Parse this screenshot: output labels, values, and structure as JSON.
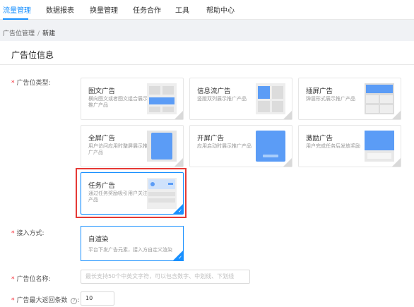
{
  "nav": {
    "items": [
      {
        "label": "流量管理",
        "active": true
      },
      {
        "label": "数据报表",
        "active": false
      },
      {
        "label": "换量管理",
        "active": false
      },
      {
        "label": "任务合作",
        "active": false
      },
      {
        "label": "工具",
        "active": false
      },
      {
        "label": "帮助中心",
        "active": false
      }
    ]
  },
  "breadcrumb": {
    "parent": "广告位管理",
    "separator": "/",
    "current": "新建"
  },
  "panel": {
    "title": "广告位信息"
  },
  "form": {
    "ad_type_label": "广告位类型:",
    "access_label": "接入方式:",
    "name_label": "广告位名称:",
    "max_count_label": "广告最大返回条数",
    "max_count_help_icon": "question-circle-icon",
    "max_count_suffix": ":"
  },
  "ad_types": [
    {
      "title": "图文广告",
      "desc": "横向图文或者图文组合展示推广产品",
      "thumb": "image-text"
    },
    {
      "title": "信息流广告",
      "desc": "竖版双列展示推广产品",
      "thumb": "feed"
    },
    {
      "title": "插屏广告",
      "desc": "弹层形式展示推广产品",
      "thumb": "interstitial"
    },
    {
      "title": "全屏广告",
      "desc": "用户访问应用时整屏展示推广产品",
      "thumb": "fullscreen"
    },
    {
      "title": "开屏广告",
      "desc": "应用启动时展示推广产品",
      "thumb": "splash"
    },
    {
      "title": "激励广告",
      "desc": "用户完成任务后发放奖励",
      "thumb": "reward"
    },
    {
      "title": "任务广告",
      "desc": "通过任务奖励吸引用户关注产品",
      "thumb": "task",
      "selected": true
    }
  ],
  "access": {
    "title": "自渲染",
    "desc": "平台下发广告元素，接入方自定义渲染",
    "selected": true
  },
  "name_input": {
    "value": "",
    "placeholder": "最长支持50个中英文字符，可以包含数字、中划线、下划线"
  },
  "max_count_input": {
    "value": "10"
  },
  "colors": {
    "accent": "#1890ff",
    "highlight": "#e53935",
    "required": "#f5222d"
  }
}
